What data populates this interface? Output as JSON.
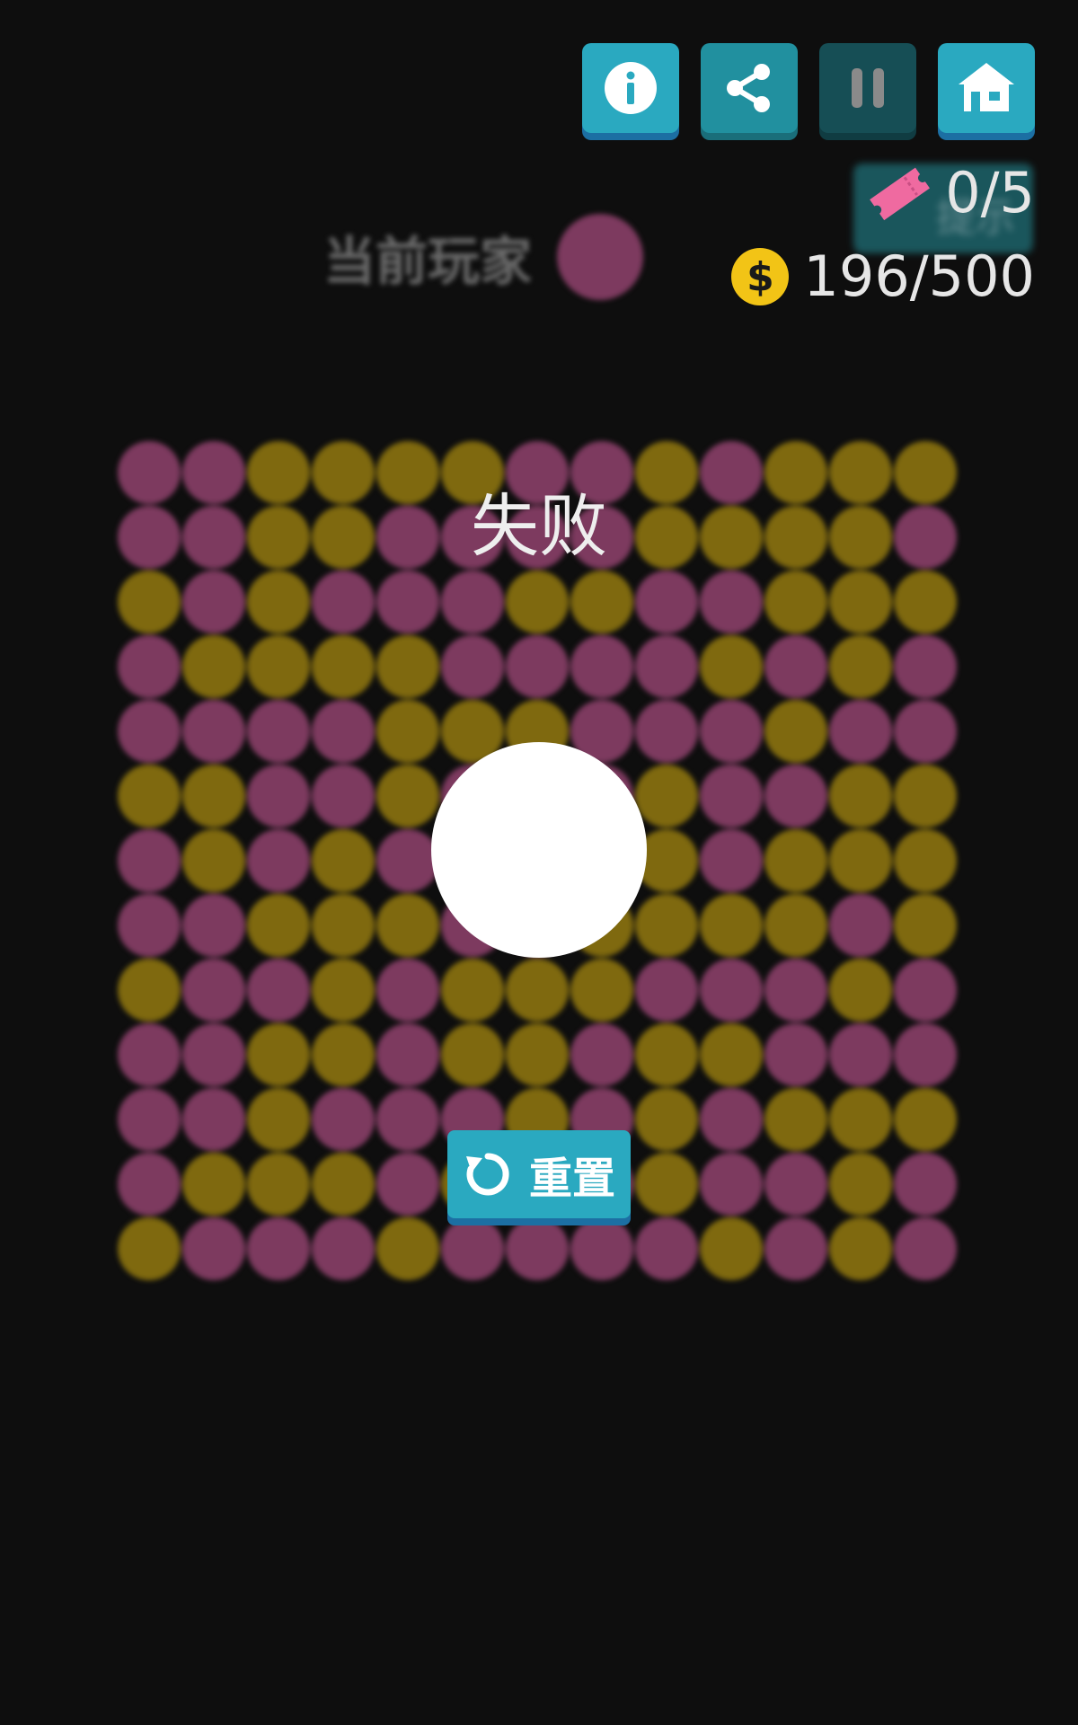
{
  "toolbar": {
    "info_icon": "info-icon",
    "share_icon": "share-icon",
    "pause_icon": "pause-icon",
    "home_icon": "home-icon"
  },
  "status": {
    "hint_label": "提示",
    "tickets": "0/5",
    "coins": "196/500",
    "coin_symbol": "$"
  },
  "current_player": {
    "label": "当前玩家",
    "color": "#7d3a5f"
  },
  "result": {
    "title": "失败"
  },
  "reset_button": {
    "label": "重置"
  },
  "colors": {
    "magenta": "#7d3a5f",
    "olive": "#7f690f",
    "accent": "#2aa9c0",
    "ticket": "#ef6aa0",
    "coin": "#f2c416"
  },
  "board": {
    "rows": [
      "MMOOOOMMOMOOO",
      "MMOOMMMMOOOOM",
      "OMOMMMOOMMOOO",
      "MOOOOMMMMOMOM",
      "MMMMOOOMMMOMM",
      "OOMMOMMMOMMOO",
      "MOMOMOOMOMOOO",
      "MMOOOMMOOOOMO",
      "OMMOMOOOMMMOM",
      "MMOOMOOMOOMMM",
      "MMOMMMOMOMOOO",
      "MOOOMOMMOMMOM",
      "OMMMOMMMMOMOM"
    ]
  }
}
